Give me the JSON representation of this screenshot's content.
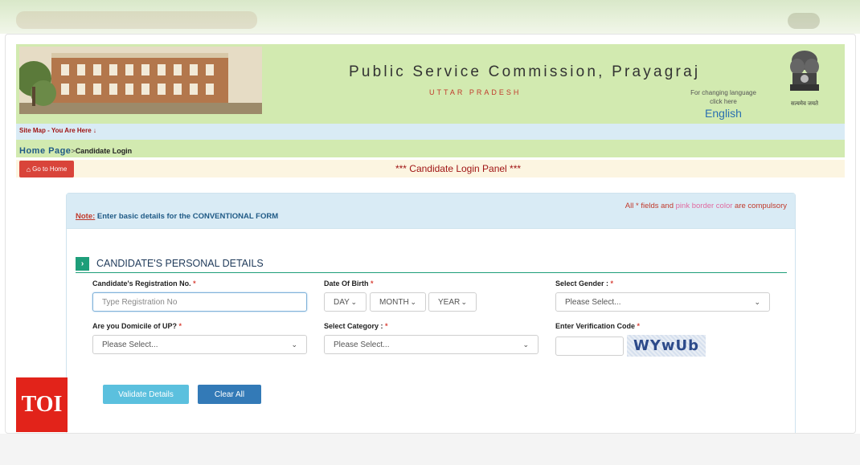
{
  "header": {
    "commission": "Public Service Commission, Prayagraj",
    "state": "UTTAR PRADESH",
    "lang_note_1": "For changing language",
    "lang_note_2": "click here",
    "language_link": "English",
    "emblem_motto": "सत्यमेव जयते"
  },
  "breadcrumb": {
    "sitemap": "Site Map - You Are Here ↓",
    "home": "Home Page",
    "separator": ">",
    "current": "Candidate Login"
  },
  "panel": {
    "home_button": "Go to Home",
    "title": "*** Candidate Login Panel ***"
  },
  "form": {
    "compulsory_prefix": "All * fields and ",
    "compulsory_pink": "pink border color",
    "compulsory_suffix": " are compulsory",
    "note_label": "Note:",
    "note_text": " Enter basic details for the CONVENTIONAL FORM",
    "section_title": "CANDIDATE'S PERSONAL DETAILS",
    "registration": {
      "label": "Candidate's Registration No.",
      "placeholder": "Type Registration No"
    },
    "dob": {
      "label": "Date Of Birth",
      "day": "DAY",
      "month": "MONTH",
      "year": "YEAR"
    },
    "gender": {
      "label": "Select Gender :",
      "value": "Please Select..."
    },
    "domicile": {
      "label": "Are you Domicile of UP?",
      "value": "Please Select..."
    },
    "category": {
      "label": "Select Category :",
      "value": "Please Select..."
    },
    "verification": {
      "label": "Enter Verification Code",
      "captcha": "WYwUb"
    },
    "validate_button": "Validate Details",
    "clear_button": "Clear All"
  },
  "watermark": "TOI",
  "colors": {
    "header_bg": "#d2eab0",
    "accent_red": "#d9443a",
    "validate": "#5bc0de",
    "clear": "#337ab7",
    "section": "#1e9e7a"
  }
}
